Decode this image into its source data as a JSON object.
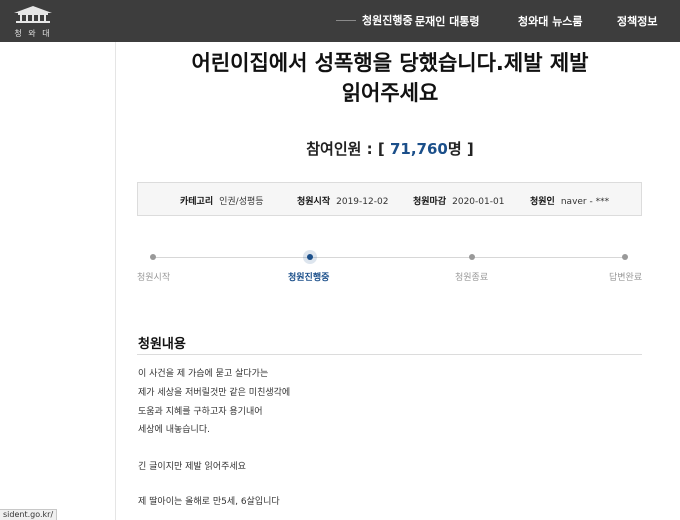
{
  "nav": {
    "logo_text": "청 와 대",
    "items": [
      "문재인 대통령",
      "청와대 뉴스룸",
      "정책정보"
    ]
  },
  "status_label": "청원진행중",
  "petition": {
    "title_line1": "어린이집에서 성폭행을 당했습니다.제발 제발",
    "title_line2": "읽어주세요",
    "participants_label": "참여인원 : [",
    "participants_value": "71,760",
    "participants_unit": "명 ]"
  },
  "info": {
    "category_label": "카테고리",
    "category_value": "인권/성평등",
    "start_label": "청원시작",
    "start_value": "2019-12-02",
    "end_label": "청원마감",
    "end_value": "2020-01-01",
    "author_label": "청원인",
    "author_value": "naver - ***"
  },
  "timeline": {
    "steps": [
      "청원시작",
      "청원진행중",
      "청원종료",
      "답변완료"
    ]
  },
  "content": {
    "heading": "청원내용",
    "lines": [
      "이 사건을 제 가슴에 묻고 살다가는",
      "제가 세상을 저버릴것만 같은 미친생각에",
      "도움과 지혜를 구하고자 용기내어",
      "세상에 내놓습니다.",
      "긴 글이지만 제발 읽어주세요",
      "제 딸아이는 올해로 만5세, 6살입니다"
    ]
  },
  "status_url": "sident.go.kr/"
}
